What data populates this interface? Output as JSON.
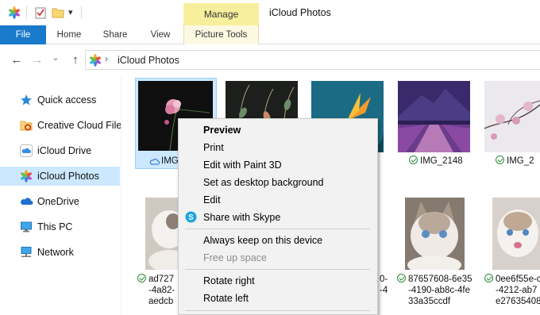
{
  "window": {
    "title": "iCloud Photos",
    "context_tab": "Manage",
    "quick_access_dropdown": "▾"
  },
  "ribbon": {
    "tabs": [
      "File",
      "Home",
      "Share",
      "View",
      "Picture Tools"
    ]
  },
  "address_bar": {
    "path": "iCloud Photos",
    "chevron": "›"
  },
  "nav_buttons": {
    "back": "←",
    "forward": "→",
    "recent": "⌄",
    "up": "↑"
  },
  "sidebar": {
    "items": [
      {
        "label": "Quick access",
        "icon": "star-icon"
      },
      {
        "label": "Creative Cloud Files",
        "icon": "creative-cloud-folder-icon"
      },
      {
        "label": "iCloud Drive",
        "icon": "icloud-icon"
      },
      {
        "label": "iCloud Photos",
        "icon": "icloud-photos-icon",
        "selected": true
      },
      {
        "label": "OneDrive",
        "icon": "onedrive-cloud-icon"
      },
      {
        "label": "This PC",
        "icon": "computer-icon"
      },
      {
        "label": "Network",
        "icon": "network-icon"
      }
    ]
  },
  "files": {
    "row1": [
      {
        "name": "IMG",
        "status": "cloud"
      },
      {
        "name": "IMG_2148",
        "status": "synced"
      },
      {
        "name": "IMG_2",
        "status": "synced"
      }
    ],
    "row2": [
      {
        "line1": "ad727",
        "line2": "-4a82-",
        "line3": "aedcb"
      },
      {
        "line1": "0-",
        "line2": "-4",
        "line3": ""
      },
      {
        "line1": "87657608-6e35",
        "line2": "-4190-ab8c-4fe",
        "line3": "33a35ccdf"
      },
      {
        "line1": "0ee6f55e-c",
        "line2": "-4212-ab7",
        "line3": "e27635408"
      }
    ]
  },
  "context_menu": {
    "items": [
      {
        "label": "Preview",
        "bold": true,
        "disabled": false
      },
      {
        "label": "Print",
        "disabled": false
      },
      {
        "label": "Edit with Paint 3D",
        "disabled": false
      },
      {
        "label": "Set as desktop background",
        "disabled": false
      },
      {
        "label": "Edit",
        "disabled": false
      },
      {
        "label": "Share with Skype",
        "disabled": false,
        "icon": "skype-icon"
      },
      {
        "label": "Always keep on this device",
        "disabled": false
      },
      {
        "label": "Free up space",
        "disabled": true
      },
      {
        "label": "Rotate right",
        "disabled": false
      },
      {
        "label": "Rotate left",
        "disabled": false
      }
    ]
  },
  "colors": {
    "accent": "#1979ca",
    "selection": "#cce8ff",
    "manage_tab": "#f7ef9c",
    "synced_green": "#2e8b3a"
  }
}
